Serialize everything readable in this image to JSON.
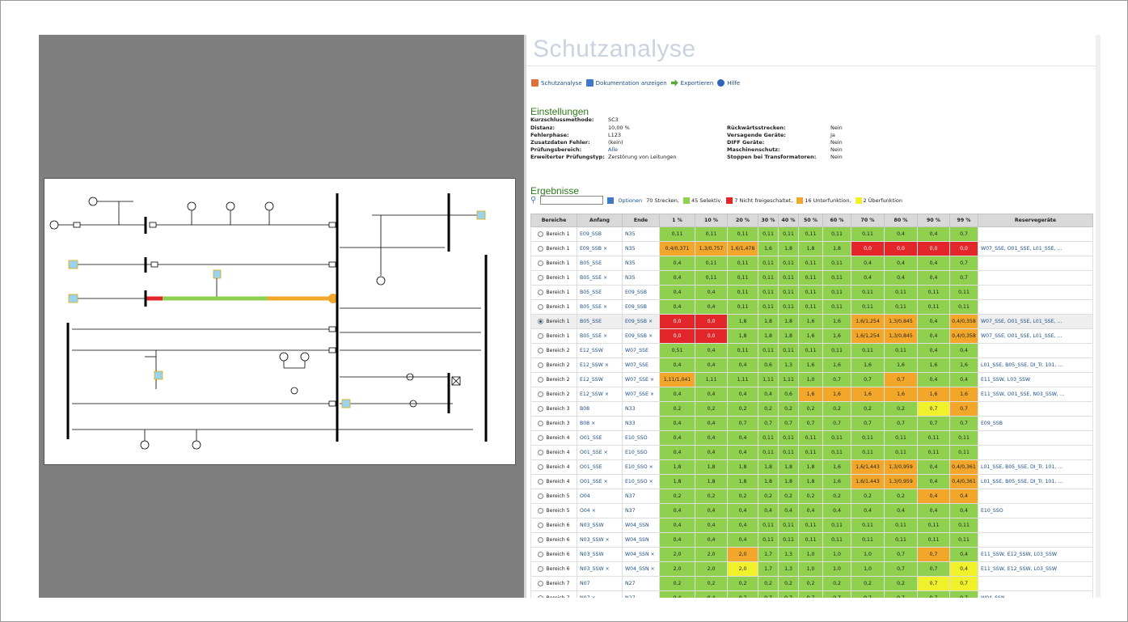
{
  "app": {
    "title": "Schutzanalyse",
    "toolbar": {
      "analysis": "Schutzanalyse",
      "documentation": "Dokumentation anzeigen",
      "export": "Exportieren",
      "help": "Hilfe"
    }
  },
  "settings": {
    "heading": "Einstellungen",
    "left": [
      {
        "label": "Kurzschlussmethode:",
        "value": "SC3",
        "link": false
      },
      {
        "label": "Distanz:",
        "value": "10,00 %",
        "link": false
      },
      {
        "label": "Fehlerphase:",
        "value": "L123",
        "link": false
      },
      {
        "label": "Zusatzdaten Fehler:",
        "value": "(kein)",
        "link": false
      },
      {
        "label": "Prüfungsbereich:",
        "value": "Alle",
        "link": true
      },
      {
        "label": "Erweiterter Prüfungstyp:",
        "value": "Zerstörung von Leitungen",
        "link": false
      }
    ],
    "right": [
      {
        "label": "Rückwärtsstrecken:",
        "value": "Nein"
      },
      {
        "label": "Versagende Geräte:",
        "value": "Ja"
      },
      {
        "label": "DIFF Geräte:",
        "value": "Nein"
      },
      {
        "label": "Maschinenschutz:",
        "value": "Nein"
      },
      {
        "label": "Stoppen bei Transformatoren:",
        "value": "Nein"
      }
    ]
  },
  "results": {
    "heading": "Ergebnisse",
    "search_value": "",
    "options_label": "Optionen",
    "summary": {
      "total": "70 Strecken,",
      "selective": "45 Selektiv,",
      "not_cleared": "7 Nicht freigeschaltet,",
      "underfunction": "16 Unterfunktion,",
      "overfunction": "2 Überfunktion"
    },
    "colors": {
      "green": "#8fd14f",
      "red": "#e3262a",
      "orange": "#f2a72b",
      "yellow": "#f1f12b"
    },
    "columns": [
      "Bereiche",
      "Anfang",
      "Ende",
      "1 %",
      "10 %",
      "20 %",
      "30 %",
      "40 %",
      "50 %",
      "60 %",
      "70 %",
      "80 %",
      "90 %",
      "99 %",
      "Reservegeräte"
    ],
    "rows": [
      {
        "area": "Bereich 1",
        "start": "E09_SSB",
        "end": "N35",
        "vals": [
          "0,11",
          "0,11",
          "0,11",
          "0,11",
          "0,11",
          "0,11",
          "0,11",
          "0,11",
          "0,4",
          "0,4",
          "0,7"
        ],
        "colors": "ggggggggggg",
        "reserve": ""
      },
      {
        "area": "Bereich 1",
        "start": "E09_SSB ×",
        "end": "N35",
        "vals": [
          "0,4/0,371",
          "1,3/0,757",
          "1,6/1,478",
          "1,6",
          "1,8",
          "1,8",
          "1,8",
          "0,0",
          "0,0",
          "0,0",
          "0,0"
        ],
        "colors": "ooogggg rrrr",
        "reserve": "W07_SSE, O01_SSE, L01_SSE, ..."
      },
      {
        "area": "Bereich 1",
        "start": "B05_SSE",
        "end": "N35",
        "vals": [
          "0,4",
          "0,11",
          "0,11",
          "0,11",
          "0,11",
          "0,11",
          "0,11",
          "0,4",
          "0,4",
          "0,4",
          "0,7"
        ],
        "colors": "ggggggggggg",
        "reserve": ""
      },
      {
        "area": "Bereich 1",
        "start": "B05_SSE ×",
        "end": "N35",
        "vals": [
          "0,4",
          "0,11",
          "0,11",
          "0,11",
          "0,11",
          "0,11",
          "0,11",
          "0,4",
          "0,4",
          "0,4",
          "0,7"
        ],
        "colors": "ggggggggggg",
        "reserve": ""
      },
      {
        "area": "Bereich 1",
        "start": "B05_SSE",
        "end": "E09_SSB",
        "vals": [
          "0,4",
          "0,4",
          "0,11",
          "0,11",
          "0,11",
          "0,11",
          "0,11",
          "0,11",
          "0,11",
          "0,11",
          "0,11"
        ],
        "colors": "ggggggggggg",
        "reserve": ""
      },
      {
        "area": "Bereich 1",
        "start": "B05_SSE ×",
        "end": "E09_SSB",
        "vals": [
          "0,4",
          "0,4",
          "0,11",
          "0,11",
          "0,11",
          "0,11",
          "0,11",
          "0,11",
          "0,11",
          "0,11",
          "0,11"
        ],
        "colors": "ggggggggggg",
        "reserve": ""
      },
      {
        "area": "Bereich 1",
        "start": "B05_SSE",
        "end": "E09_SSB ×",
        "vals": [
          "0,0",
          "0,0",
          "1,8",
          "1,8",
          "1,8",
          "1,6",
          "1,6",
          "1,6/1,254",
          "1,3/0,845",
          "0,4",
          "0,4/0,358"
        ],
        "colors": "rrgggggoogo",
        "reserve": "W07_SSE, O01_SSE, L01_SSE, ...",
        "selected": true
      },
      {
        "area": "Bereich 1",
        "start": "B05_SSE ×",
        "end": "E09_SSB ×",
        "vals": [
          "0,0",
          "0,0",
          "1,8",
          "1,8",
          "1,8",
          "1,6",
          "1,6",
          "1,6/1,254",
          "1,3/0,845",
          "0,4",
          "0,4/0,358"
        ],
        "colors": "rrgggggoogo",
        "reserve": "W07_SSE, O01_SSE, L01_SSE, ..."
      },
      {
        "area": "Bereich 2",
        "start": "E12_SSW",
        "end": "W07_SSE",
        "vals": [
          "0,51",
          "0,4",
          "0,11",
          "0,11",
          "0,11",
          "0,11",
          "0,11",
          "0,11",
          "0,11",
          "0,4",
          "0,4"
        ],
        "colors": "ggggggggggg",
        "reserve": ""
      },
      {
        "area": "Bereich 2",
        "start": "E12_SSW ×",
        "end": "W07_SSE",
        "vals": [
          "0,4",
          "0,4",
          "0,4",
          "0,6",
          "1,3",
          "1,6",
          "1,6",
          "1,6",
          "1,6",
          "1,6",
          "1,6"
        ],
        "colors": "ggggggggggg",
        "reserve": "L01_SSE, B05_SSE, DI_Tr. 101, ..."
      },
      {
        "area": "Bereich 2",
        "start": "E12_SSW",
        "end": "W07_SSE ×",
        "vals": [
          "1,11/1,041",
          "1,11",
          "1,11",
          "1,11",
          "1,11",
          "1,0",
          "0,7",
          "0,7",
          "0,7",
          "0,4",
          "0,4"
        ],
        "colors": "ogggggggogg",
        "reserve": "E11_SSW, L03_SSW"
      },
      {
        "area": "Bereich 2",
        "start": "E12_SSW ×",
        "end": "W07_SSE ×",
        "vals": [
          "0,4",
          "0,4",
          "0,4",
          "0,4",
          "0,6",
          "1,6",
          "1,6",
          "1,6",
          "1,6",
          "1,6",
          "1,6"
        ],
        "colors": "gggggoooooo",
        "reserve": "E11_SSW, O01_SSE, N03_SSW, ..."
      },
      {
        "area": "Bereich 3",
        "start": "B08",
        "end": "N33",
        "vals": [
          "0,2",
          "0,2",
          "0,2",
          "0,2",
          "0,2",
          "0,2",
          "0,2",
          "0,2",
          "0,2",
          "0,7",
          "0,7"
        ],
        "colors": "gggggggggyo",
        "reserve": ""
      },
      {
        "area": "Bereich 3",
        "start": "B08 ×",
        "end": "N33",
        "vals": [
          "0,4",
          "0,4",
          "0,7",
          "0,7",
          "0,7",
          "0,7",
          "0,7",
          "0,7",
          "0,7",
          "0,7",
          "0,7"
        ],
        "colors": "ggggggggggg",
        "reserve": "E09_SSB"
      },
      {
        "area": "Bereich 4",
        "start": "O01_SSE",
        "end": "E10_SSO",
        "vals": [
          "0,4",
          "0,4",
          "0,4",
          "0,11",
          "0,11",
          "0,11",
          "0,11",
          "0,11",
          "0,11",
          "0,11",
          "0,11"
        ],
        "colors": "ggggggggggg",
        "reserve": ""
      },
      {
        "area": "Bereich 4",
        "start": "O01_SSE ×",
        "end": "E10_SSO",
        "vals": [
          "0,4",
          "0,4",
          "0,4",
          "0,11",
          "0,11",
          "0,11",
          "0,11",
          "0,11",
          "0,11",
          "0,11",
          "0,11"
        ],
        "colors": "ggggggggggg",
        "reserve": ""
      },
      {
        "area": "Bereich 4",
        "start": "O01_SSE",
        "end": "E10_SSO ×",
        "vals": [
          "1,8",
          "1,8",
          "1,8",
          "1,8",
          "1,8",
          "1,8",
          "1,6",
          "1,6/1,443",
          "1,3/0,959",
          "0,4",
          "0,4/0,361"
        ],
        "colors": "gggggggoogo",
        "reserve": "L01_SSE, B05_SSE, DI_Tr. 101, ..."
      },
      {
        "area": "Bereich 4",
        "start": "O01_SSE ×",
        "end": "E10_SSO ×",
        "vals": [
          "1,8",
          "1,8",
          "1,8",
          "1,8",
          "1,8",
          "1,8",
          "1,6",
          "1,6/1,443",
          "1,3/0,959",
          "0,4",
          "0,4/0,361"
        ],
        "colors": "gggggggoogo",
        "reserve": "L01_SSE, B05_SSE, DI_Tr. 101, ..."
      },
      {
        "area": "Bereich 5",
        "start": "O04",
        "end": "N37",
        "vals": [
          "0,2",
          "0,2",
          "0,2",
          "0,2",
          "0,2",
          "0,2",
          "0,2",
          "0,2",
          "0,2",
          "0,4",
          "0,4"
        ],
        "colors": "gggggggggoo",
        "reserve": ""
      },
      {
        "area": "Bereich 5",
        "start": "O04 ×",
        "end": "N37",
        "vals": [
          "0,4",
          "0,4",
          "0,4",
          "0,4",
          "0,4",
          "0,4",
          "0,4",
          "0,4",
          "0,4",
          "0,4",
          "0,4"
        ],
        "colors": "ggggggggggg",
        "reserve": "E10_SSO"
      },
      {
        "area": "Bereich 6",
        "start": "N03_SSW",
        "end": "W04_SSN",
        "vals": [
          "0,4",
          "0,4",
          "0,4",
          "0,11",
          "0,11",
          "0,11",
          "0,11",
          "0,11",
          "0,11",
          "0,11",
          "0,11"
        ],
        "colors": "ggggggggggg",
        "reserve": ""
      },
      {
        "area": "Bereich 6",
        "start": "N03_SSW ×",
        "end": "W04_SSN",
        "vals": [
          "0,4",
          "0,4",
          "0,4",
          "0,11",
          "0,11",
          "0,11",
          "0,11",
          "0,11",
          "0,11",
          "0,11",
          "0,11"
        ],
        "colors": "ggggggggggg",
        "reserve": ""
      },
      {
        "area": "Bereich 6",
        "start": "N03_SSW",
        "end": "W04_SSN ×",
        "vals": [
          "2,0",
          "2,0",
          "2,0",
          "1,7",
          "1,3",
          "1,0",
          "1,0",
          "1,0",
          "0,7",
          "0,7",
          "0,4"
        ],
        "colors": "ggoggggggog",
        "reserve": "E11_SSW, E12_SSW, L03_SSW"
      },
      {
        "area": "Bereich 6",
        "start": "N03_SSW ×",
        "end": "W04_SSN ×",
        "vals": [
          "2,0",
          "2,0",
          "2,0",
          "1,7",
          "1,3",
          "1,0",
          "1,0",
          "1,0",
          "0,7",
          "0,7",
          "0,4"
        ],
        "colors": "ggygggggggyg",
        "reserve": "E11_SSW, E12_SSW, L03_SSW"
      },
      {
        "area": "Bereich 7",
        "start": "N07",
        "end": "N27",
        "vals": [
          "0,2",
          "0,2",
          "0,2",
          "0,2",
          "0,2",
          "0,2",
          "0,2",
          "0,2",
          "0,2",
          "0,7",
          "0,7"
        ],
        "colors": "gggggggggyy",
        "reserve": ""
      },
      {
        "area": "Bereich 7",
        "start": "N07 ×",
        "end": "N27",
        "vals": [
          "0,4",
          "0,4",
          "0,7",
          "0,7",
          "0,7",
          "0,7",
          "0,7",
          "0,7",
          "0,7",
          "0,7",
          "0,7"
        ],
        "colors": "ggggggggggg",
        "reserve": "W04_SSN"
      }
    ]
  }
}
